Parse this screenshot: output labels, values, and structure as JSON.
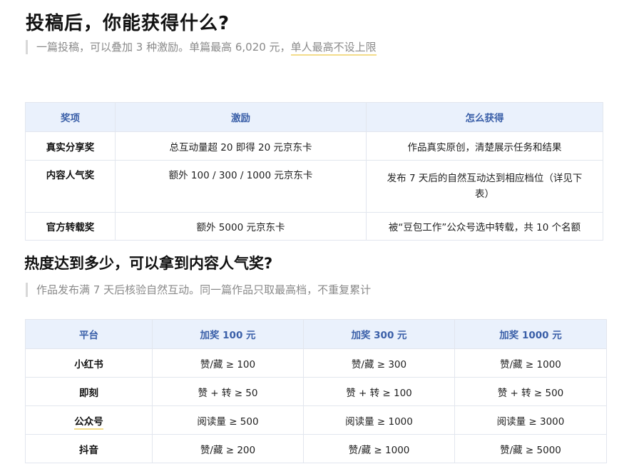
{
  "section1": {
    "title": "投稿后，你能获得什么?",
    "note_main": "一篇投稿，可以叠加 3 种激励。单篇最高 6,020 元，",
    "note_highlight": "单人最高不设上限",
    "table": {
      "headers": [
        "奖项",
        "激励",
        "怎么获得"
      ],
      "rows": [
        {
          "award": "真实分享奖",
          "reward": "总互动量超 20 即得 20 元京东卡",
          "how": "作品真实原创，清楚展示任务和结果"
        },
        {
          "award": "内容人气奖",
          "reward": "额外 100 / 300 / 1000 元京东卡",
          "how": "发布 7 天后的自然互动达到相应档位（详见下表）"
        },
        {
          "award": "官方转载奖",
          "reward": "额外 5000 元京东卡",
          "how": "被“豆包工作”公众号选中转载，共 10 个名额"
        }
      ]
    }
  },
  "section2": {
    "title": "热度达到多少，可以拿到内容人气奖?",
    "note": "作品发布满 7 天后核验自然互动。同一篇作品只取最高档，不重复累计",
    "table": {
      "headers": [
        "平台",
        "加奖 100 元",
        "加奖 300 元",
        "加奖 1000 元"
      ],
      "rows": [
        {
          "platform": "小红书",
          "t100": "赞/藏 ≥ 100",
          "t300": "赞/藏 ≥ 300",
          "t1000": "赞/藏 ≥ 1000"
        },
        {
          "platform": "即刻",
          "t100": "赞 + 转 ≥ 50",
          "t300": "赞 + 转 ≥ 100",
          "t1000": "赞 + 转 ≥ 500"
        },
        {
          "platform": "公众号",
          "t100": "阅读量 ≥ 500",
          "t300": "阅读量 ≥ 1000",
          "t1000": "阅读量 ≥ 3000"
        },
        {
          "platform": "抖音",
          "t100": "赞/藏 ≥ 200",
          "t300": "赞/藏 ≥ 1000",
          "t1000": "赞/藏 ≥ 5000"
        }
      ]
    }
  }
}
